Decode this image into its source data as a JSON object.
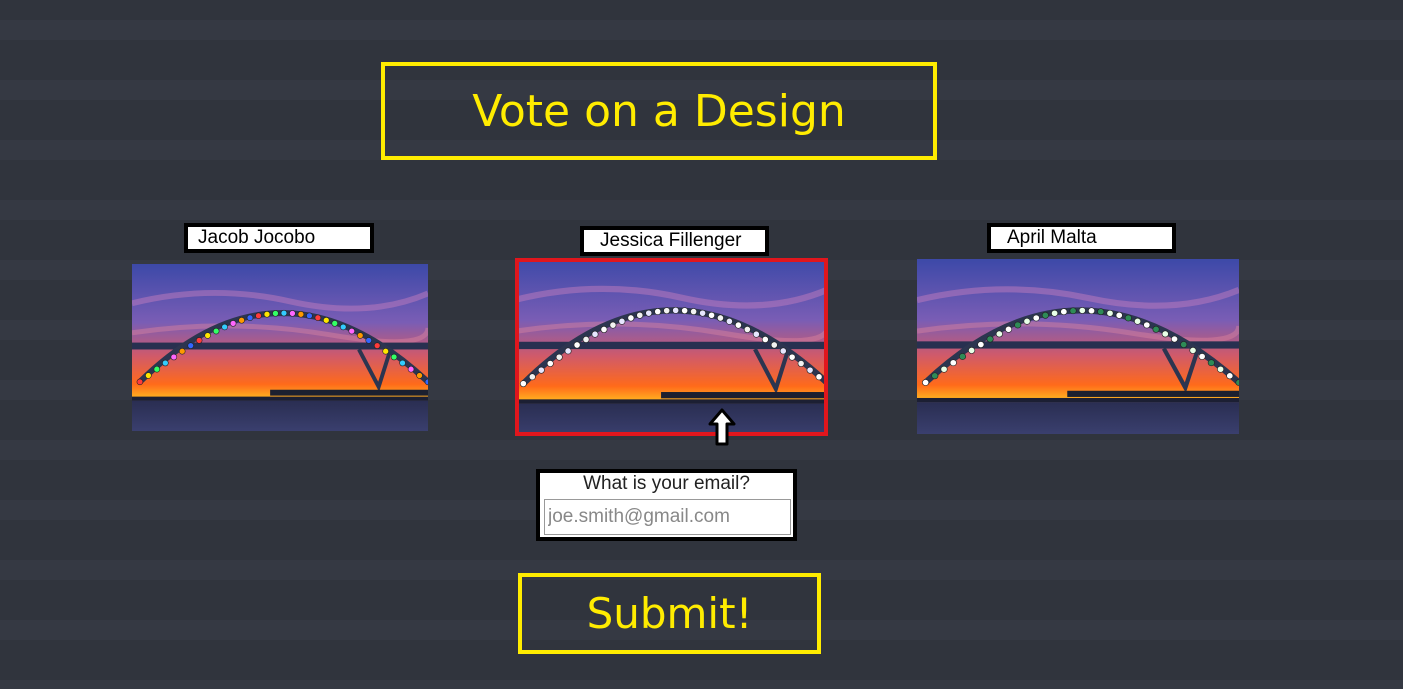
{
  "header": {
    "title": "Vote on a Design"
  },
  "designs": [
    {
      "designer": "Jacob Jocobo",
      "light_style": "multicolor-lights",
      "selected": false
    },
    {
      "designer": "Jessica Fillenger",
      "light_style": "white-lights",
      "selected": true
    },
    {
      "designer": "April Malta",
      "light_style": "white-green-lights",
      "selected": false
    }
  ],
  "email": {
    "label": "What is your email?",
    "placeholder": "joe.smith@gmail.com",
    "value": ""
  },
  "submit": {
    "label": "Submit!"
  },
  "colors": {
    "accent": "#ffec00",
    "selection": "#e0161d",
    "background": "#30343d"
  }
}
